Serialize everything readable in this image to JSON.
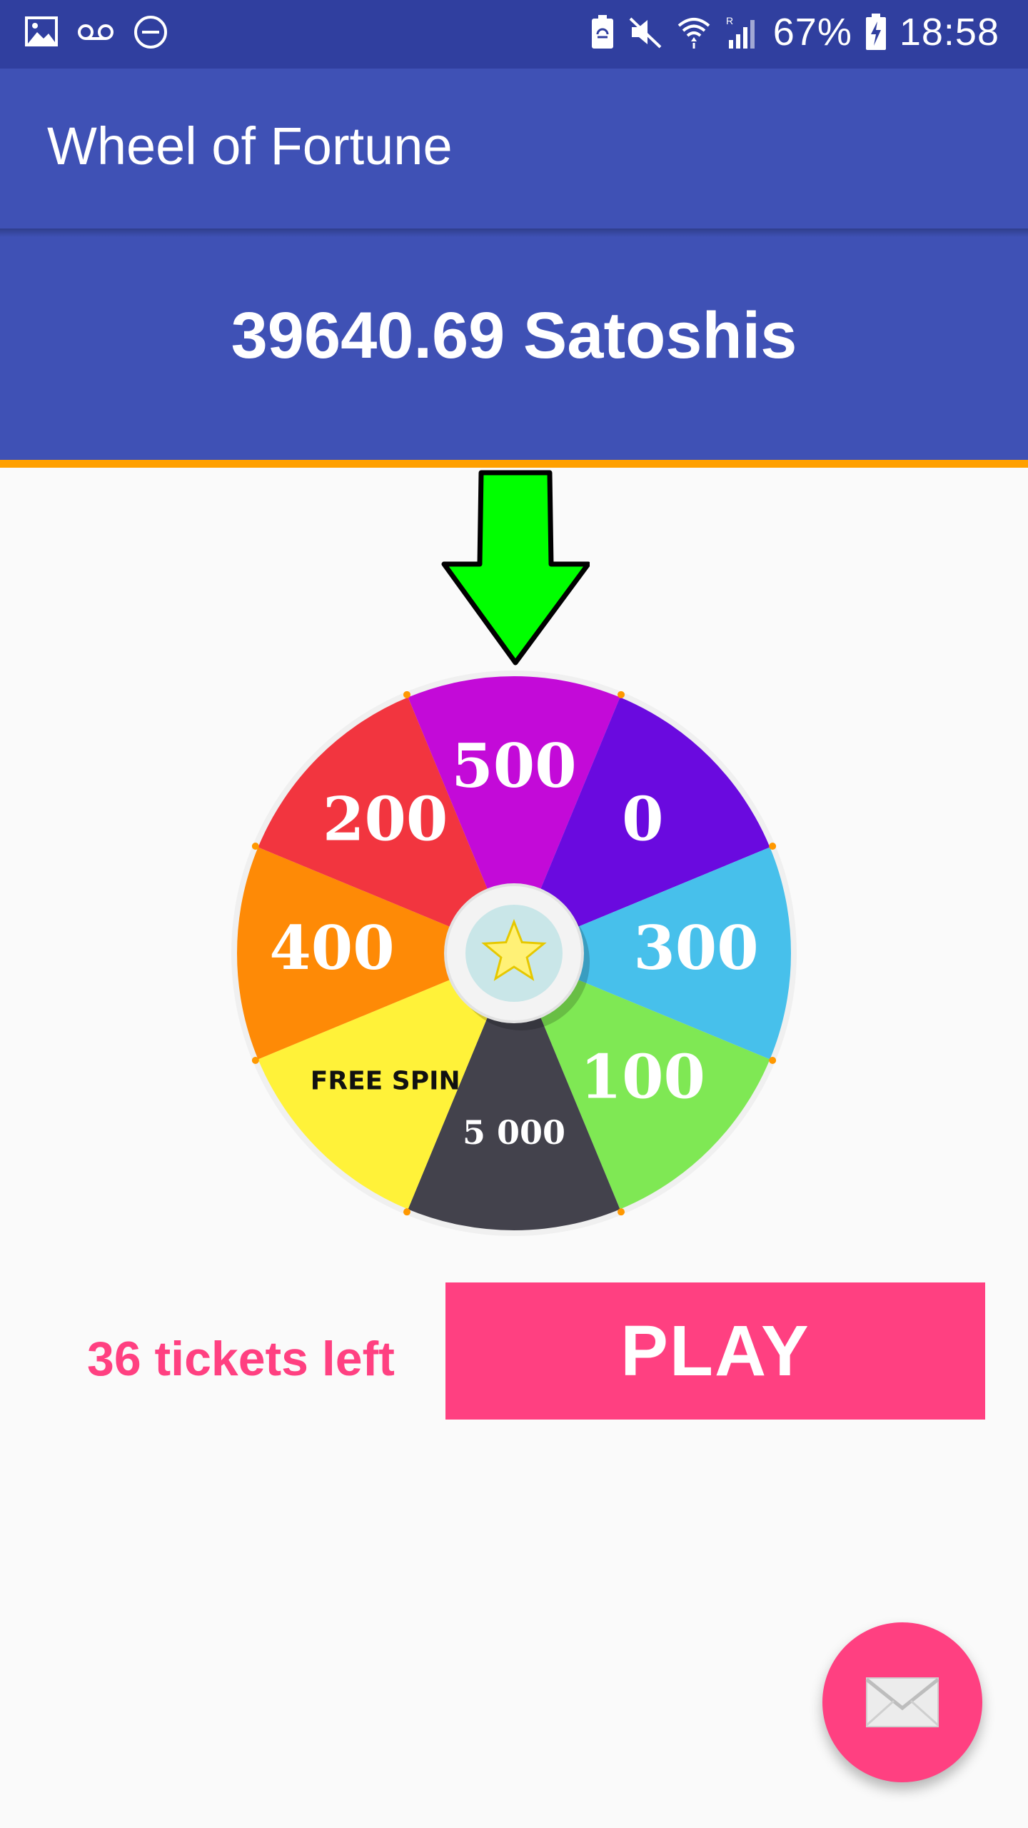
{
  "status_bar": {
    "battery_percent": "67%",
    "time": "18:58",
    "left_icons": [
      "image-icon",
      "voicemail-icon",
      "do-not-disturb-icon"
    ],
    "right_icons": [
      "battery-saver-icon",
      "mute-icon",
      "wifi-icon",
      "signal-icon",
      "battery-charging-icon"
    ]
  },
  "app_bar": {
    "title": "Wheel of Fortune"
  },
  "balance": {
    "text": "39640.69 Satoshis"
  },
  "wheel": {
    "segments": [
      {
        "label": "500",
        "color": "#c30ad8"
      },
      {
        "label": "0",
        "color": "#6a0adf"
      },
      {
        "label": "300",
        "color": "#47c0eb"
      },
      {
        "label": "100",
        "color": "#7fe854"
      },
      {
        "label": "5 000",
        "color": "#43424c"
      },
      {
        "label": "FREE SPIN",
        "color": "#fff239"
      },
      {
        "label": "400",
        "color": "#fe8a06"
      },
      {
        "label": "200",
        "color": "#f2353f"
      }
    ],
    "center_icon": "star-icon",
    "pointer_color": "#00ff00"
  },
  "controls": {
    "tickets_text": "36 tickets left",
    "play_label": "PLAY"
  },
  "fab": {
    "icon": "mail-icon"
  },
  "colors": {
    "primary": "#3f51b5",
    "primary_dark": "#303f9f",
    "accent": "#ff4081",
    "divider": "#ffa000"
  }
}
